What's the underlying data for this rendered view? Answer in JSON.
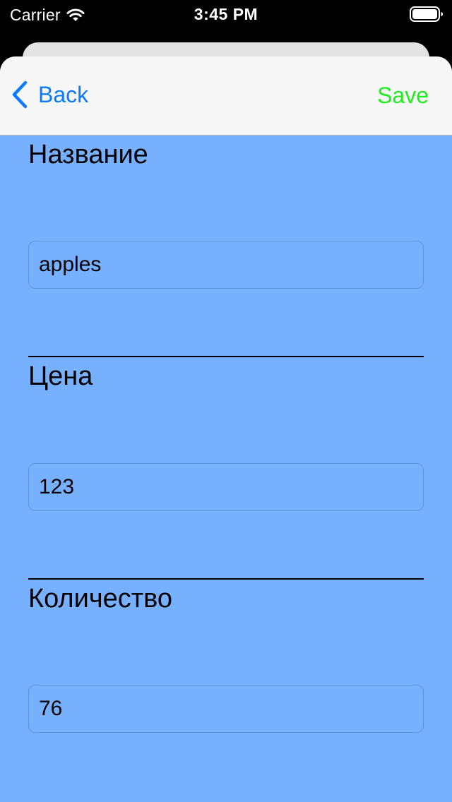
{
  "status_bar": {
    "carrier": "Carrier",
    "time": "3:45 PM"
  },
  "nav": {
    "back_label": "Back",
    "save_label": "Save",
    "back_color": "#0a7aff",
    "save_color": "#21ee21"
  },
  "form": {
    "background_color": "#77b0ff",
    "fields": [
      {
        "label": "Название",
        "value": "apples"
      },
      {
        "label": "Цена",
        "value": "123"
      },
      {
        "label": "Количество",
        "value": "76"
      }
    ]
  }
}
